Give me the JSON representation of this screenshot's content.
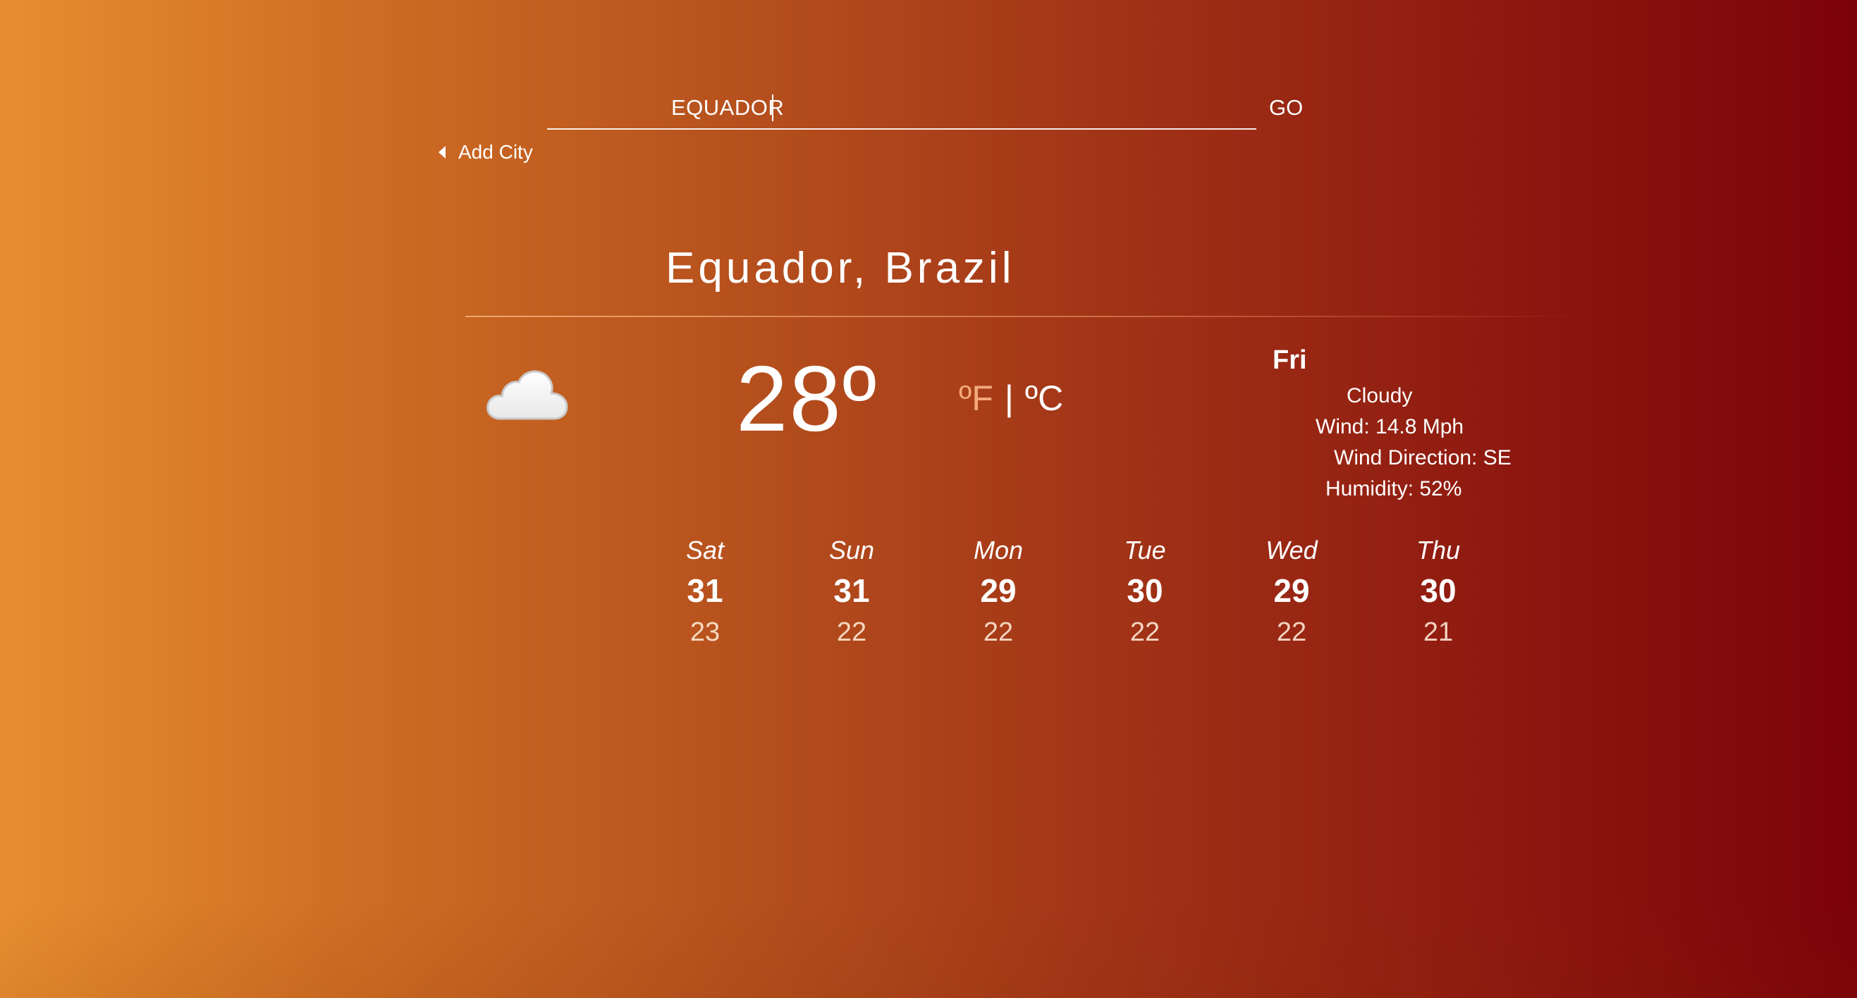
{
  "search": {
    "value": "EQUADOR",
    "go_label": "GO"
  },
  "nav": {
    "add_city_label": "Add City"
  },
  "location": {
    "title": "Equador, Brazil"
  },
  "current": {
    "icon": "cloud-icon",
    "temperature": "28º",
    "unit_f": "ºF",
    "unit_separator": "|",
    "unit_c": "ºC",
    "selected_unit": "C",
    "day": "Fri",
    "condition": "Cloudy",
    "wind": "Wind: 14.8 Mph",
    "wind_direction": "Wind Direction: SE",
    "humidity": "Humidity: 52%"
  },
  "forecast": [
    {
      "day": "Sat",
      "high": "31",
      "low": "23"
    },
    {
      "day": "Sun",
      "high": "31",
      "low": "22"
    },
    {
      "day": "Mon",
      "high": "29",
      "low": "22"
    },
    {
      "day": "Tue",
      "high": "30",
      "low": "22"
    },
    {
      "day": "Wed",
      "high": "29",
      "low": "22"
    },
    {
      "day": "Thu",
      "high": "30",
      "low": "21"
    }
  ],
  "colors": {
    "gradient_start": "#e78f30",
    "gradient_end": "#7c0209",
    "text": "#ffffff"
  }
}
